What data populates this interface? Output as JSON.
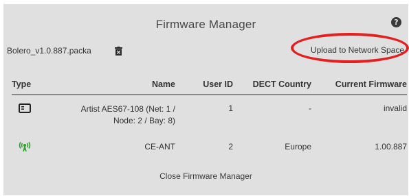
{
  "dialog": {
    "title": "Firmware Manager",
    "help_icon": "question-circle-icon",
    "filename": "Bolero_v1.0.887.packa",
    "trash_icon": "trash-icon",
    "upload_label": "Upload to Network Space",
    "close_label": "Close Firmware Manager"
  },
  "table": {
    "headers": {
      "type": "Type",
      "name": "Name",
      "user_id": "User ID",
      "dect_country": "DECT Country",
      "current_firmware": "Current Firmware"
    },
    "rows": [
      {
        "type_icon": "device-unit-icon",
        "name_line1": "Artist AES67-108 (Net: 1 /",
        "name_line2": "Node: 2 / Bay: 8)",
        "user_id": "1",
        "dect_country": "-",
        "current_firmware": "invalid"
      },
      {
        "type_icon": "antenna-icon",
        "name_line1": "CE-ANT",
        "user_id": "2",
        "dect_country": "Europe",
        "current_firmware": "1.00.887"
      }
    ]
  },
  "colors": {
    "dialog_bg": "#e0e0e0",
    "antenna": "#2e9e2e",
    "highlight_ring": "#e41f1f"
  }
}
